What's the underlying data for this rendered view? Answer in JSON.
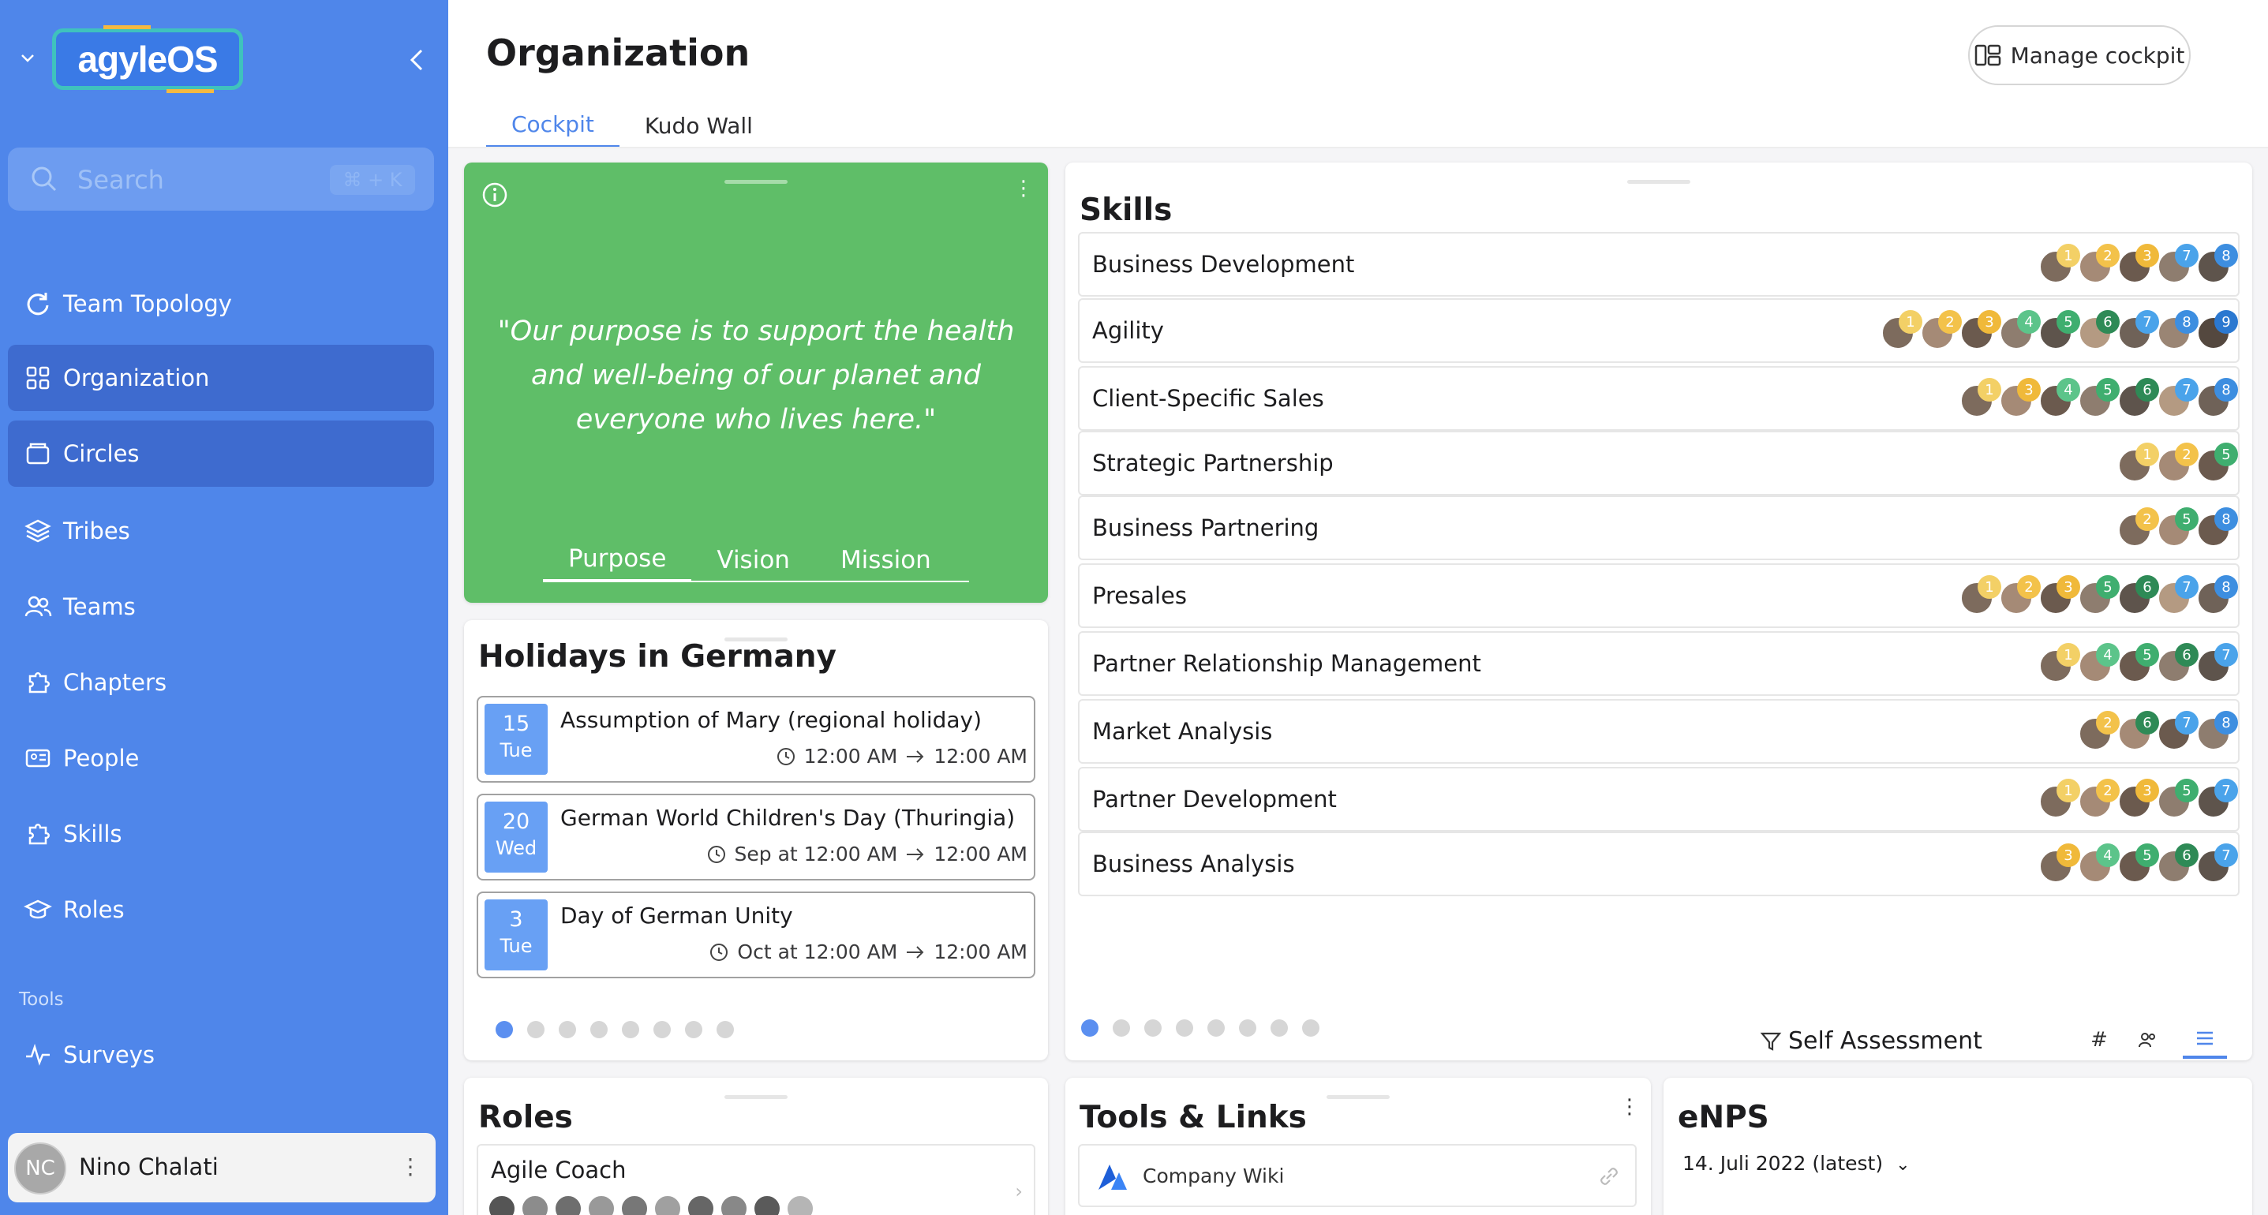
{
  "sidebar": {
    "logo_text": "agyleOS",
    "search_placeholder": "Search",
    "search_shortcut": "⌘ + K",
    "nav": [
      {
        "label": "Team Topology",
        "icon": "refresh-icon"
      },
      {
        "label": "Organization",
        "icon": "grid-icon",
        "active": true
      },
      {
        "label": "Circles",
        "icon": "folder-icon",
        "active": true
      },
      {
        "label": "Tribes",
        "icon": "layers-icon"
      },
      {
        "label": "Teams",
        "icon": "users-icon"
      },
      {
        "label": "Chapters",
        "icon": "puzzle-icon"
      },
      {
        "label": "People",
        "icon": "id-card-icon"
      },
      {
        "label": "Skills",
        "icon": "puzzle-icon"
      },
      {
        "label": "Roles",
        "icon": "graduation-cap-icon"
      }
    ],
    "tools_heading": "Tools",
    "tools": [
      {
        "label": "Surveys",
        "icon": "pulse-icon"
      }
    ],
    "user": {
      "initials": "NC",
      "name": "Nino Chalati"
    }
  },
  "header": {
    "title": "Organization",
    "manage_label": "Manage cockpit",
    "tabs": [
      {
        "label": "Cockpit",
        "active": true
      },
      {
        "label": "Kudo Wall"
      }
    ]
  },
  "purpose_card": {
    "quote": "\"Our purpose is to support the health and well-being of our planet and everyone who lives here.\"",
    "tabs": [
      "Purpose",
      "Vision",
      "Mission"
    ]
  },
  "holidays": {
    "title": "Holidays in Germany",
    "items": [
      {
        "day": "15",
        "weekday": "Tue",
        "name": "Assumption of Mary (regional holiday)",
        "start": "12:00 AM",
        "end": "12:00 AM"
      },
      {
        "day": "20",
        "weekday": "Wed",
        "name": "German World Children's Day (Thuringia)",
        "start": "Sep at 12:00 AM",
        "end": "12:00 AM"
      },
      {
        "day": "3",
        "weekday": "Tue",
        "name": "Day of German Unity",
        "start": "Oct at 12:00 AM",
        "end": "12:00 AM"
      }
    ]
  },
  "skills": {
    "title": "Skills",
    "rows": [
      {
        "name": "Business Development",
        "badges": [
          "1",
          "2",
          "3",
          "7",
          "8"
        ]
      },
      {
        "name": "Agility",
        "badges": [
          "1",
          "2",
          "3",
          "4",
          "5",
          "6",
          "7",
          "8",
          "9"
        ]
      },
      {
        "name": "Client-Specific Sales",
        "badges": [
          "1",
          "3",
          "4",
          "5",
          "6",
          "7",
          "8"
        ]
      },
      {
        "name": "Strategic Partnership",
        "badges": [
          "1",
          "2",
          "5"
        ]
      },
      {
        "name": "Business Partnering",
        "badges": [
          "2",
          "5",
          "8"
        ]
      },
      {
        "name": "Presales",
        "badges": [
          "1",
          "2",
          "3",
          "5",
          "6",
          "7",
          "8"
        ]
      },
      {
        "name": "Partner Relationship Management",
        "badges": [
          "1",
          "4",
          "5",
          "6",
          "7"
        ]
      },
      {
        "name": "Market Analysis",
        "badges": [
          "2",
          "6",
          "7",
          "8"
        ]
      },
      {
        "name": "Partner Development",
        "badges": [
          "1",
          "2",
          "3",
          "5",
          "7"
        ]
      },
      {
        "name": "Business Analysis",
        "badges": [
          "3",
          "4",
          "5",
          "6",
          "7"
        ]
      }
    ],
    "self_assessment": "Self Assessment",
    "hash": "#"
  },
  "roles": {
    "title": "Roles",
    "first": "Agile Coach"
  },
  "tools_links": {
    "title": "Tools & Links",
    "first": "Company Wiki"
  },
  "enps": {
    "title": "eNPS",
    "date": "14. Juli 2022 (latest)"
  },
  "colors": {
    "sidebar": "#4f86ea",
    "active": "#3e6bcf",
    "green": "#5fbe68",
    "accent": "#4f86ea"
  }
}
